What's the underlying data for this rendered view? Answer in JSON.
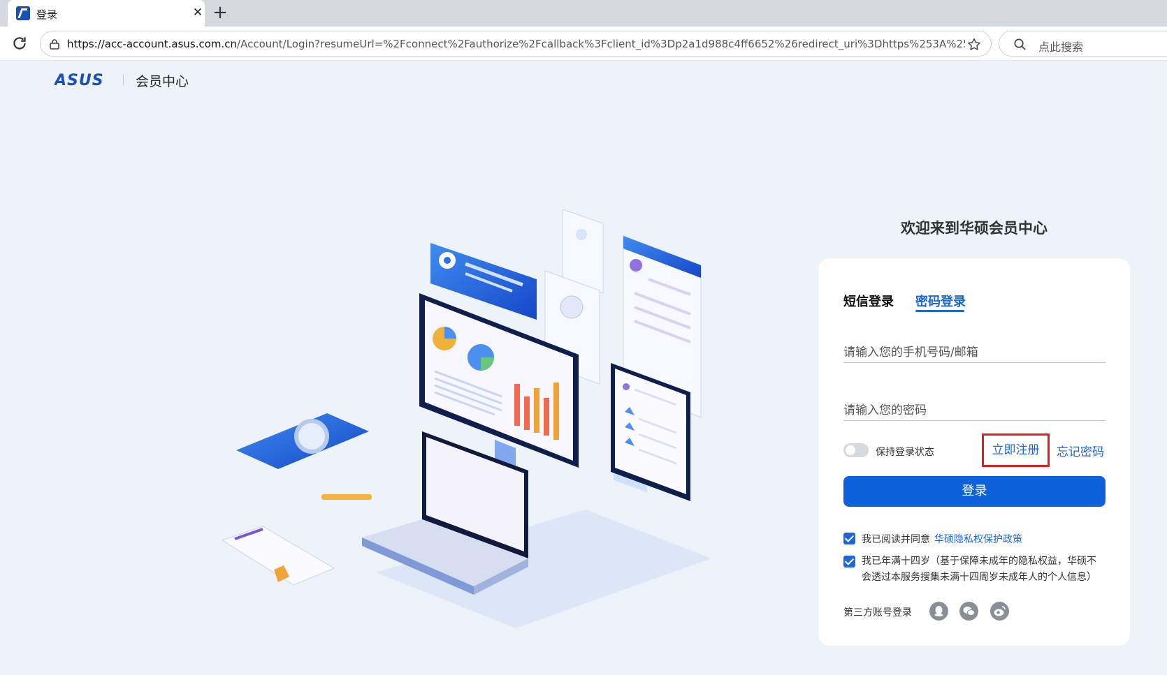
{
  "browser": {
    "tab_title": "登录",
    "url_host": "https://acc-account.asus.com.cn",
    "url_path": "/Account/Login?resumeUrl=%2Fconnect%2Fauthorize%2Fcallback%3Fclient_id%3Dp2a1d988c4ff6652%26redirect_uri%3Dhttps%253A%252F%...",
    "search_placeholder": "点此搜索"
  },
  "header": {
    "logo": "ASUS",
    "title": "会员中心"
  },
  "login": {
    "welcome": "欢迎来到华硕会员中心",
    "tabs": {
      "sms": "短信登录",
      "password": "密码登录",
      "active": "password"
    },
    "account_placeholder": "请输入您的手机号码/邮箱",
    "password_placeholder": "请输入您的密码",
    "remember_label": "保持登录状态",
    "remember_on": false,
    "register_link": "立即注册",
    "forgot_link": "忘记密码",
    "submit_label": "登录",
    "agree_text": "我已阅读并同意",
    "privacy_link": "华硕隐私权保护政策",
    "age_text": "我已年满十四岁（基于保障未成年的隐私权益，华硕不会透过本服务搜集未满十四周岁未成年人的个人信息）",
    "third_party_label": "第三方账号登录",
    "third_party_icons": [
      "qq-icon",
      "wechat-icon",
      "weibo-icon"
    ]
  },
  "colors": {
    "accent": "#0d62dc",
    "link": "#1d67d8",
    "highlight_box": "#e01c1c",
    "page_bg": "#eef2f9"
  }
}
